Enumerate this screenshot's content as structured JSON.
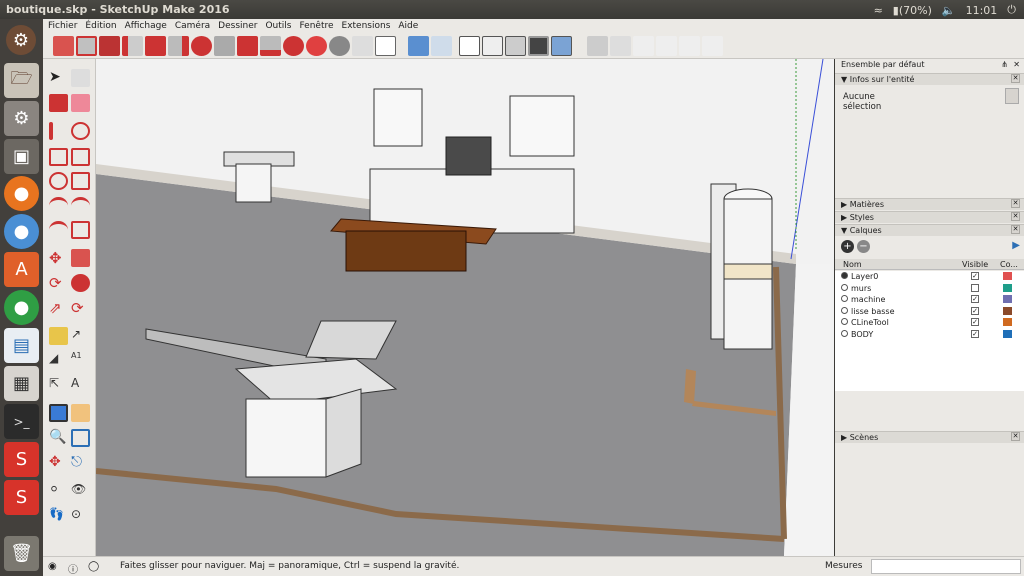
{
  "window": {
    "title": "boutique.skp - SketchUp Make 2016"
  },
  "tray": {
    "wifi": "wifi-icon",
    "battery": "(70%)",
    "volume": "volume-icon",
    "time": "11:01",
    "power": "power-icon"
  },
  "launcher": [
    "ubuntu-home-icon",
    "files-icon",
    "settings-icon",
    "terminal-window-icon",
    "firefox-icon",
    "chromium-icon",
    "software-center-icon",
    "chrome-icon",
    "libreoffice-writer-icon",
    "calculator-icon",
    "terminal-icon",
    "sketchup-icon",
    "sketchup-layout-icon",
    "trash-icon"
  ],
  "menu": [
    "Fichier",
    "Édition",
    "Affichage",
    "Caméra",
    "Dessiner",
    "Outils",
    "Fenêtre",
    "Extensions",
    "Aide"
  ],
  "panel": {
    "tray_title": "Ensemble par défaut",
    "entity_info": {
      "title": "Infos sur l'entité",
      "value": "Aucune sélection"
    },
    "materials": "Matières",
    "styles": "Styles",
    "layers": {
      "title": "Calques",
      "headers": {
        "name": "Nom",
        "visible": "Visible",
        "color": "Co..."
      },
      "rows": [
        {
          "name": "Layer0",
          "active": true,
          "visible": true,
          "color": "#e05050"
        },
        {
          "name": "murs",
          "active": false,
          "visible": false,
          "color": "#1e9e8a"
        },
        {
          "name": "machine",
          "active": false,
          "visible": true,
          "color": "#6f6fb0"
        },
        {
          "name": "lisse basse",
          "active": false,
          "visible": true,
          "color": "#8b4a2a"
        },
        {
          "name": "CLineTool",
          "active": false,
          "visible": true,
          "color": "#d06a20"
        },
        {
          "name": "BODY",
          "active": false,
          "visible": true,
          "color": "#1f6fb8"
        }
      ]
    },
    "scenes": "Scènes"
  },
  "status": {
    "hint": "Faites glisser pour naviguer. Maj = panoramique, Ctrl =  suspend la gravité.",
    "measure_label": "Mesures",
    "measure_value": ""
  }
}
